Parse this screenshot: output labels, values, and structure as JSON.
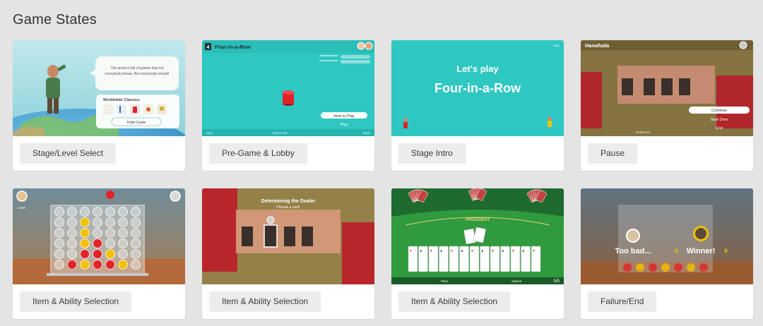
{
  "page": {
    "title": "Game States"
  },
  "cards": [
    {
      "label": "Stage/Level Select",
      "thumb": {
        "bubble_text_1": "The world is full of games that not",
        "bubble_text_2": "everybody knows. But everybody should!",
        "panel_title": "Worldwide Classics",
        "button": "Invite Guide"
      }
    },
    {
      "label": "Pre-Game & Lobby",
      "thumb": {
        "game_number": "4",
        "game_title": "Four-in-a-Row",
        "menu_1": "How to Play",
        "menu_2": "Play",
        "footer_left": "Intro",
        "footer_mid": "Game Info",
        "footer_right": "Back"
      }
    },
    {
      "label": "Stage Intro",
      "thumb": {
        "line_1": "Let's play",
        "line_2": "Four-in-a-Row",
        "corner": "Skip"
      }
    },
    {
      "label": "Pause",
      "thumb": {
        "title": "Hanafuda",
        "menu_1": "Continue",
        "menu_2": "Start Over",
        "menu_3": "End",
        "footer": "Reference"
      }
    },
    {
      "label": "Item & Ability Selection",
      "thumb": {
        "corner": "Level"
      }
    },
    {
      "label": "Item & Ability Selection",
      "thumb": {
        "title": "Determining the Dealer",
        "subtitle": "Choose a card."
      }
    },
    {
      "label": "Item & Ability Selection",
      "thumb": {
        "table_text": "PRESIDENT",
        "footer_left": "Pass",
        "footer_mid": "Submit",
        "count": "5/5"
      }
    },
    {
      "label": "Failure/End",
      "thumb": {
        "left_text": "Too bad...",
        "right_text": "Winner!"
      }
    }
  ],
  "colors": {
    "page_bg": "#e4e4e4",
    "card_bg": "#ffffff",
    "label_bg": "#ececec",
    "teal": "#2ec7c2",
    "felt_green": "#2f9a3e",
    "red_token": "#e0242a",
    "yellow_token": "#f2c200"
  }
}
